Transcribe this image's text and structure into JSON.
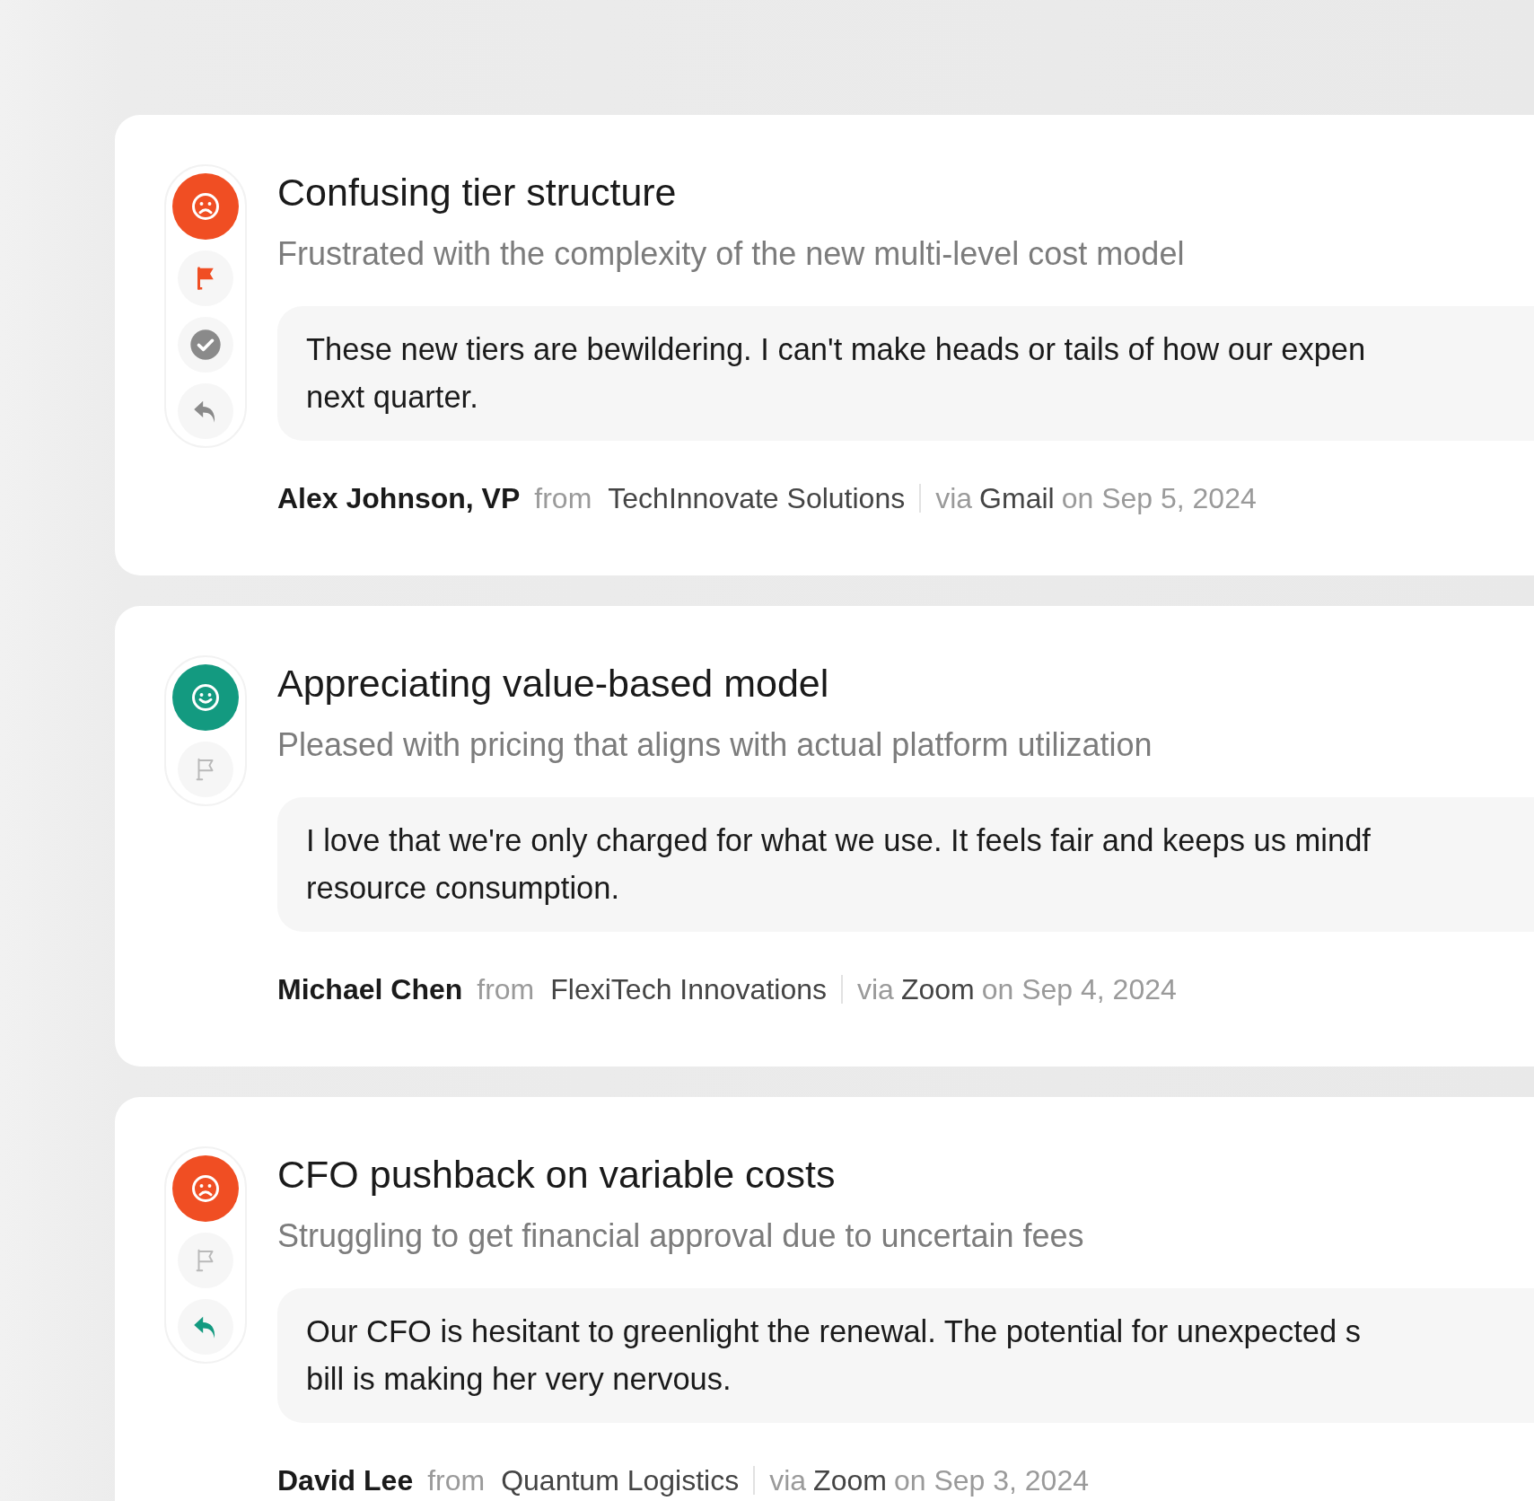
{
  "feedback": [
    {
      "kind": "negative",
      "actions": [
        {
          "kind": "flag",
          "on": true
        },
        {
          "kind": "resolve"
        },
        {
          "kind": "reply",
          "on": false
        }
      ],
      "title": "Confusing tier structure",
      "summary": "Frustrated with the complexity of the new multi-level cost model",
      "quote_lines": [
        "These new tiers are bewildering. I can't make heads or tails of how our expen",
        "next quarter."
      ],
      "author": "Alex Johnson, VP",
      "from_label": "from",
      "company": "TechInnovate Solutions",
      "via_label": "via",
      "channel": "Gmail",
      "date": "on Sep 5, 2024"
    },
    {
      "kind": "positive",
      "actions": [
        {
          "kind": "flag",
          "on": false
        }
      ],
      "title": "Appreciating value-based model",
      "summary": "Pleased with pricing that aligns with actual platform utilization",
      "quote_lines": [
        "I love that we're only charged for what we use. It feels fair and keeps us mindf",
        "resource consumption."
      ],
      "author": "Michael Chen",
      "from_label": "from",
      "company": "FlexiTech Innovations",
      "via_label": "via",
      "channel": "Zoom",
      "date": "on Sep 4, 2024"
    },
    {
      "kind": "negative",
      "actions": [
        {
          "kind": "flag",
          "on": false
        },
        {
          "kind": "reply",
          "on": true
        }
      ],
      "title": "CFO pushback on variable costs",
      "summary": "Struggling to get financial approval due to uncertain fees",
      "quote_lines": [
        "Our CFO is hesitant to greenlight the renewal. The potential for unexpected s",
        "bill is making her very nervous."
      ],
      "author": "David Lee",
      "from_label": "from",
      "company": "Quantum Logistics",
      "via_label": "via",
      "channel": "Zoom",
      "date": "on Sep 3, 2024"
    }
  ]
}
